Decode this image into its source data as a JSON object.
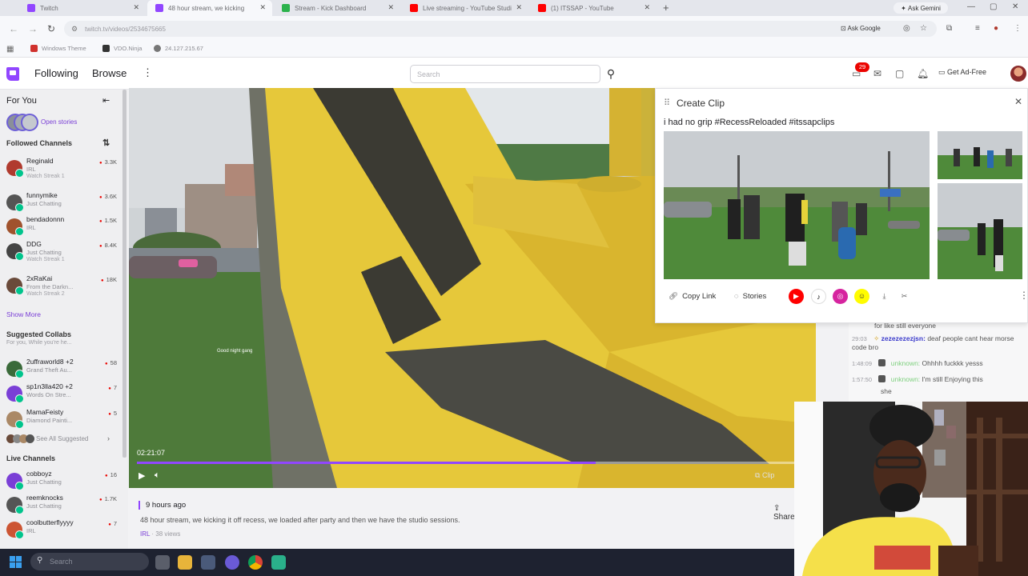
{
  "browser": {
    "tabs": [
      {
        "label": "Twitch",
        "fav_color": "#9146ff",
        "active": false
      },
      {
        "label": "48 hour stream, we kicking",
        "fav_color": "#9146ff",
        "active": true
      },
      {
        "label": "Stream - Kick Dashboard",
        "fav_color": "#2bb24c",
        "active": false
      },
      {
        "label": "Live streaming - YouTube Studi",
        "fav_color": "#ff0000",
        "active": false
      },
      {
        "label": "(1) ITSSAP - YouTube",
        "fav_color": "#ff0000",
        "active": false
      }
    ],
    "ask_gemini": "Ask Gemini",
    "url": "twitch.tv/videos/2534675665",
    "ask_google": "Ask Google",
    "bookmarks": [
      {
        "label": "Windows Theme",
        "color": "#d0312d"
      },
      {
        "label": "VDO.Ninja",
        "color": "#333333"
      },
      {
        "label": "24.127.215.67",
        "color": "#777777"
      }
    ]
  },
  "twitch": {
    "nav": {
      "following": "Following",
      "browse": "Browse",
      "search_placeholder": "Search",
      "notif_count": "29",
      "get_ad_free": "Get Ad-Free"
    },
    "sidebar": {
      "for_you": "For You",
      "open_stories": "Open stories",
      "followed_channels": "Followed Channels",
      "followed": [
        {
          "name": "Reginald",
          "category": "IRL",
          "watch": "Watch Streak 1",
          "viewers": "3.3K",
          "color": "#b03a2e"
        },
        {
          "name": "funnymike",
          "category": "Just Chatting",
          "watch": "",
          "viewers": "3.6K",
          "color": "#555555"
        },
        {
          "name": "bendadonnn",
          "category": "IRL",
          "watch": "",
          "viewers": "1.5K",
          "color": "#a0522d"
        },
        {
          "name": "DDG",
          "category": "Just Chatting",
          "watch": "Watch Streak 1",
          "viewers": "8.4K",
          "color": "#444444"
        },
        {
          "name": "2xRaKai",
          "category": "From the Darkn...",
          "watch": "Watch Streak 2",
          "viewers": "18K",
          "color": "#6a4a3a"
        }
      ],
      "show_more": "Show More",
      "suggested_collabs": "Suggested Collabs",
      "suggested_sub": "For you, While you're he...",
      "suggested": [
        {
          "name": "2uffraworld8 +2",
          "category": "Grand Theft Au...",
          "viewers": "58",
          "color": "#3a6a3a"
        },
        {
          "name": "sp1n3lla420 +2",
          "category": "Words On Stre...",
          "viewers": "7",
          "color": "#7a3fd6"
        },
        {
          "name": "MamaFeisty",
          "category": "Diamond Painti...",
          "viewers": "5",
          "color": "#aa8866"
        }
      ],
      "see_all_suggested": "See All Suggested",
      "live_channels": "Live Channels",
      "live": [
        {
          "name": "cobboyz",
          "category": "Just Chatting",
          "viewers": "16",
          "color": "#7a3fd6"
        },
        {
          "name": "reemknocks",
          "category": "Just Chatting",
          "viewers": "1.7K",
          "color": "#555555"
        },
        {
          "name": "coolbutterflyyyy",
          "category": "IRL",
          "viewers": "7",
          "color": "#cc5533"
        }
      ]
    },
    "video": {
      "time": "02:21:07",
      "progress": 0.69,
      "clip_label": "Clip",
      "overlay_text": "Good night gang"
    },
    "below": {
      "ago": "9 hours ago",
      "title": "48 hour stream, we kicking it off recess, we loaded after party and then we have the studio sessions.",
      "category": "IRL",
      "views": "38 views",
      "share": "Share"
    },
    "clip": {
      "title": "Create Clip",
      "caption": "i had no grip #RecessReloaded #itssapclips",
      "copy_link": "Copy Link",
      "stories": "Stories",
      "socials": [
        {
          "name": "youtube-icon",
          "color": "#ff0000",
          "glyph": "▶"
        },
        {
          "name": "tiktok-icon",
          "color": "#ffffff",
          "glyph": "♪"
        },
        {
          "name": "instagram-icon",
          "color": "#d6249f",
          "glyph": "◎"
        },
        {
          "name": "snapchat-icon",
          "color": "#fffc00",
          "glyph": "☺"
        }
      ]
    },
    "chat": [
      {
        "time": "",
        "user": "",
        "msg": "for like still everyone",
        "user_style": ""
      },
      {
        "time": "29:03",
        "user": "zezezezezjsn:",
        "msg": "deaf people cant hear morse code bro",
        "user_style": "b"
      },
      {
        "time": "1:48:09",
        "user": "unknown:",
        "msg": "Ohhhh fuckkk yesss",
        "user_style": "g"
      },
      {
        "time": "1:57:50",
        "user": "unknown:",
        "msg": "I'm still Enjoying this",
        "user_style": "g"
      },
      {
        "time": "",
        "user": "",
        "msg": "she",
        "user_style": ""
      }
    ]
  },
  "taskbar": {
    "search_placeholder": "Search"
  }
}
